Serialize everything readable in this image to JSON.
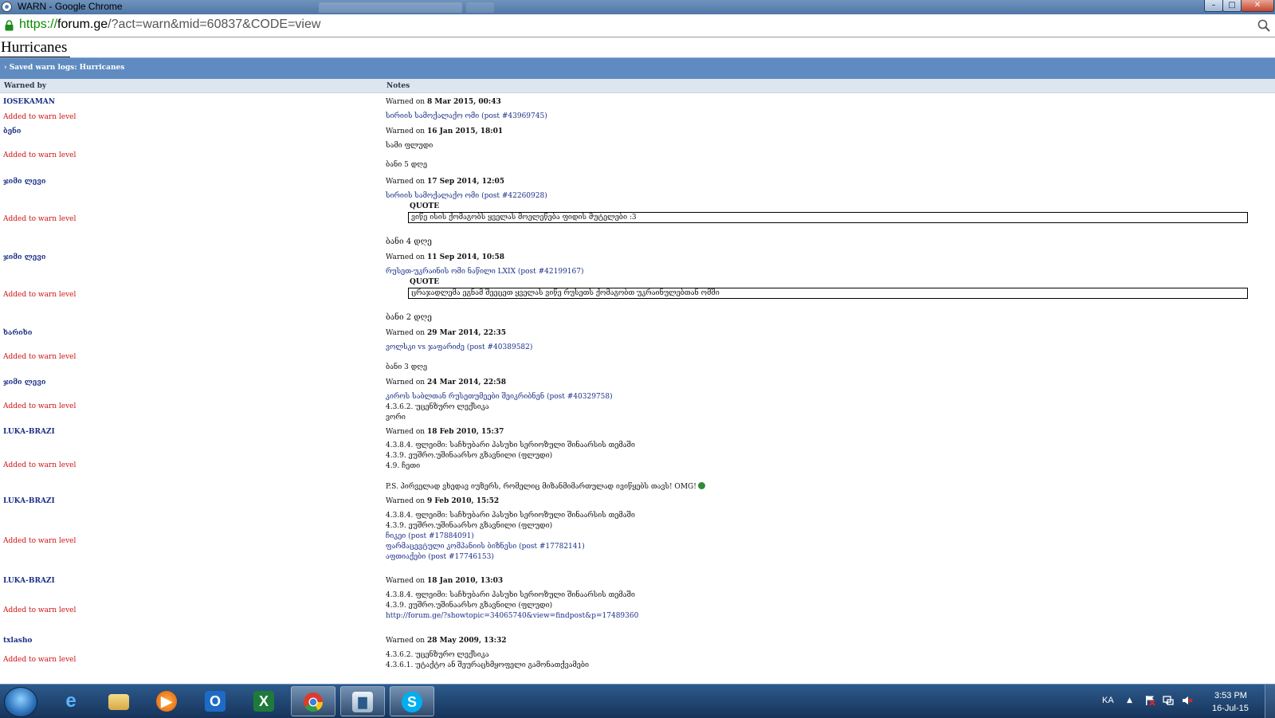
{
  "window": {
    "title": "WARN - Google Chrome",
    "minimize": "–",
    "maximize": "□",
    "close": "✕"
  },
  "address": {
    "scheme": "https://",
    "host": "forum.ge",
    "path": "/?act=warn&mid=60837&CODE=view"
  },
  "page": {
    "title": "Hurricanes",
    "section": "› Saved warn logs: Hurricanes",
    "col_warned_by": "Warned by",
    "col_notes": "Notes"
  },
  "quote_label": "QUOTE",
  "added_label": "Added to warn level",
  "warned_on_label": "Warned on",
  "warns": [
    {
      "by": "IOSEKAMAN",
      "date": "8 Mar 2015, 00:43",
      "lines": [
        "სირიის სამოქალაქო ომი (post #43969745)"
      ]
    },
    {
      "by": "ბენი",
      "date": "16 Jan 2015, 18:01",
      "lines": [
        "სამი ფლუდი",
        "ბანი 5 დღე"
      ]
    },
    {
      "by": "ჯიმი ლევი",
      "date": "17 Sep 2014, 12:05",
      "lines": [
        "სირიის სამოქალაქო ომი (post #42260928)"
      ],
      "quote": "ვიწე ისის ქომაგობს ყველას მოელეწება ფიდის მუტელები :3",
      "after": "ბანი 4 დღე"
    },
    {
      "by": "ჯიმი ლევი",
      "date": "11 Sep 2014, 10:58",
      "lines": [
        "რუსეთ-უკრაინის ომი ნაწილი LXIX (post #42199167)"
      ],
      "quote": "ცრაჯადლემა ეგნამ შეეცეთ ყველას ვიწე რუსეთს ქომაგობთ უკრაინულებთან ომში",
      "after": "ბანი 2 დღე"
    },
    {
      "by": "ხარიხი",
      "date": "29 Mar 2014, 22:35",
      "lines": [
        "ვოლსკი vs ჯაფარიძე (post #40389582)",
        "ბანი 3 დღე"
      ]
    },
    {
      "by": "ჯიმი ლევი",
      "date": "24 Mar 2014, 22:58",
      "lines": [
        "კიროს საბლთან რუსეთუმეები შეიკრიბნენ (post #40329758)",
        "4.3.6.2. უცენზურო ლექსიკა",
        "ვორი"
      ]
    },
    {
      "by": "LUKA-BRAZI",
      "date": "18 Feb 2010, 15:37",
      "lines": [
        "4.3.8.4. ფლეიმი: საჩხუბარი პასუხი სერიოზული შინაარსის თემაში",
        "4.3.9. ეუშრო.უშინაარსო გზავნილი (ფლუდი)",
        "4.9. ჩეთი",
        "P.S. პირველად ვხედავ იუზერს, რომელიც მიზანმიმართულად ივიწყებს თავს! OMG!"
      ]
    },
    {
      "by": "LUKA-BRAZI",
      "date": "9 Feb 2010, 15:52",
      "lines": [
        "4.3.8.4. ფლეიმი: საჩხუბარი პასუხი სერიოზული შინაარსის თემაში",
        "4.3.9. ეუშრო.უშინაარსო გზავნილი (ფლუდი)",
        "ჩიკეი (post #17884091)",
        "ფარმაცევტული კომპანიის ბიზნესი (post #17782141)",
        "აფთიაქები (post #17746153)"
      ]
    },
    {
      "by": "LUKA-BRAZI",
      "date": "18 Jan 2010, 13:03",
      "lines": [
        "4.3.8.4. ფლეიმი: საჩხუბარი პასუხი სერიოზული შინაარსის თემაში",
        "4.3.9. ეუშრო.უშინაარსო გზავნილი (ფლუდი)",
        "http://forum.ge/?showtopic=34065740&view=findpost&p=17489360"
      ]
    },
    {
      "by": "txlasho",
      "date": "28 May 2009, 13:32",
      "lines": [
        "4.3.6.2. უცენზურო ლექსიკა",
        "4.3.6.1. უტაქტო ან შეურაცხმყოფელი გამონათქვამები"
      ]
    }
  ],
  "taskbar": {
    "apps": [
      "internet-explorer",
      "file-explorer",
      "media-player",
      "outlook",
      "excel",
      "chrome",
      "task-manager",
      "skype"
    ],
    "lang": "KA",
    "arrow": "▲",
    "time": "3:53 PM",
    "date": "16-Jul-15"
  }
}
